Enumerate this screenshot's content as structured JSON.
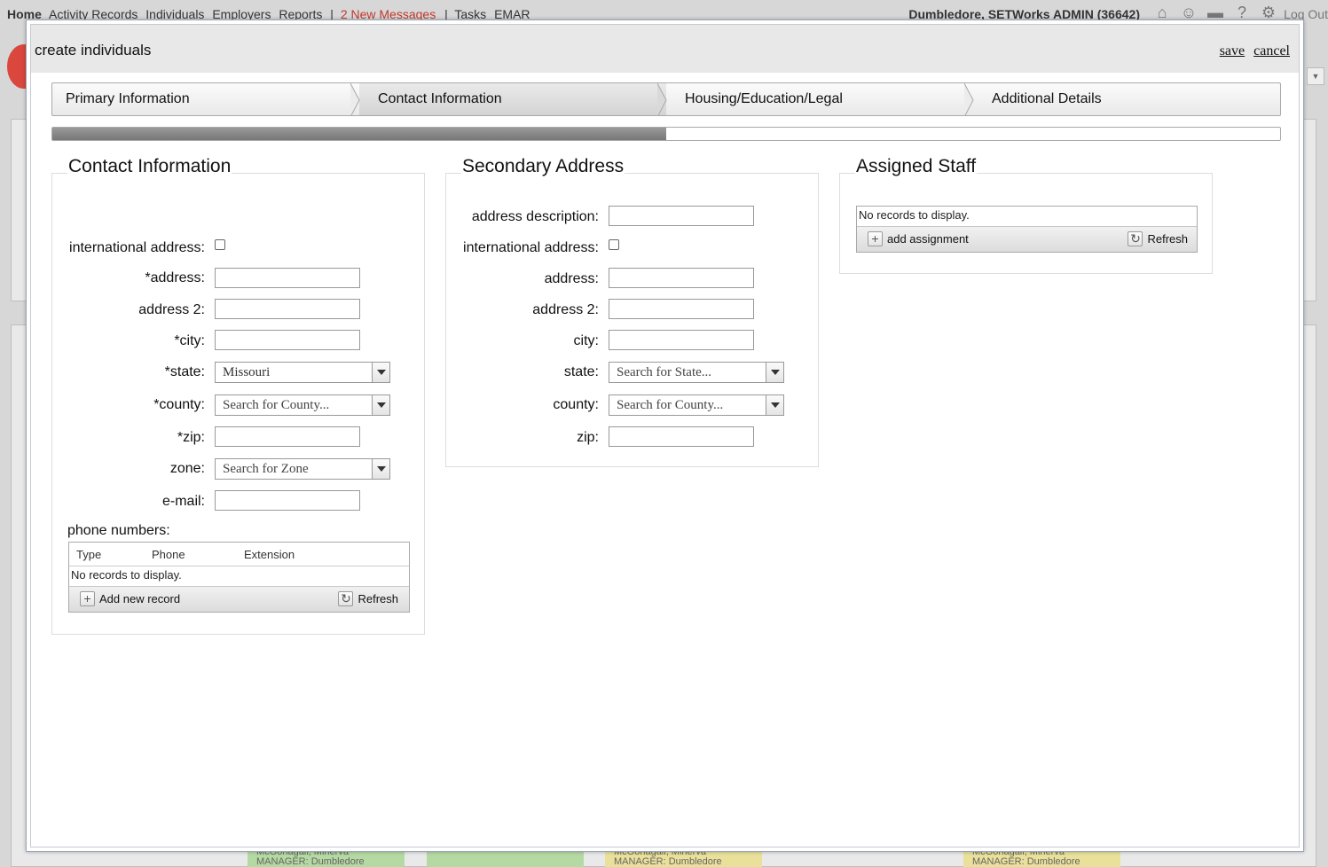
{
  "topnav": {
    "links": [
      "Home",
      "Activity Records",
      "Individuals",
      "Employers",
      "Reports"
    ],
    "separator": "|",
    "messages": "2 New Messages",
    "links2": [
      "Tasks",
      "EMAR"
    ],
    "user": "Dumbledore, SETWorks ADMIN (36642)",
    "logout": "Log Out",
    "icons": [
      "home-icon",
      "people-icon",
      "inbox-icon",
      "help-icon",
      "gear-icon"
    ]
  },
  "background": {
    "cards": [
      {
        "line1": "McGonagall, Minerva",
        "line2": "MANAGER: Dumbledore",
        "color": "#b5d9a2"
      },
      {
        "line1": "",
        "line2": "",
        "color": "#b5d9a2"
      },
      {
        "line1": "McGonagall, Minerva",
        "line2": "MANAGER: Dumbledore",
        "color": "#e9e19a"
      },
      {
        "line1": "McGonagall, Minerva",
        "line2": "MANAGER: Dumbledore",
        "color": "#e9e19a"
      }
    ]
  },
  "modal": {
    "title": "create individuals",
    "save": "save",
    "cancel": "cancel",
    "steps": [
      "Primary Information",
      "Contact Information",
      "Housing/Education/Legal",
      "Additional Details"
    ],
    "active_step": 1,
    "progress": 0.5
  },
  "contact": {
    "legend": "Contact Information",
    "international_label": "international address:",
    "address_label": "*address:",
    "address2_label": "address 2:",
    "city_label": "*city:",
    "state_label": "*state:",
    "state_value": "Missouri",
    "county_label": "*county:",
    "county_placeholder": "Search for County...",
    "zip_label": "*zip:",
    "zone_label": "zone:",
    "zone_placeholder": "Search for Zone",
    "email_label": "e-mail:",
    "phone_label": "phone numbers:",
    "phone_grid": {
      "columns": [
        "Type",
        "Phone",
        "Extension"
      ],
      "empty": "No records to display.",
      "add": "Add new record",
      "refresh": "Refresh"
    }
  },
  "secondary": {
    "legend": "Secondary Address",
    "description_label": "address description:",
    "international_label": "international address:",
    "address_label": "address:",
    "address2_label": "address 2:",
    "city_label": "city:",
    "state_label": "state:",
    "state_placeholder": "Search for State...",
    "county_label": "county:",
    "county_placeholder": "Search for County...",
    "zip_label": "zip:"
  },
  "staff": {
    "legend": "Assigned Staff",
    "empty": "No records to display.",
    "add": "add assignment",
    "refresh": "Refresh"
  }
}
